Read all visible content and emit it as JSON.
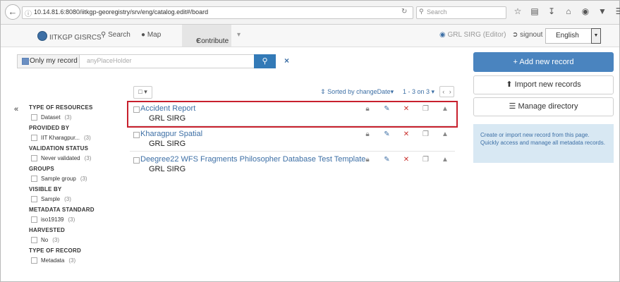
{
  "browser": {
    "back_icon": "back-arrow-icon",
    "url": "10.14.81.6:8080/iitkgp-georegistry/srv/eng/catalog.edit#/board",
    "search_placeholder": "Search"
  },
  "nav": {
    "brand": "IITKGP GISRCS",
    "search": "Search",
    "map": "Map",
    "contribute": "Contribute",
    "user": "GRL SIRG (Editor)",
    "signout": "signout",
    "language": "English"
  },
  "search": {
    "only_my_record": "Only my record",
    "placeholder": "anyPlaceHolder"
  },
  "facets": [
    {
      "heading": "TYPE OF RESOURCES",
      "items": [
        {
          "label": "Dataset",
          "count": "(3)"
        }
      ]
    },
    {
      "heading": "PROVIDED BY",
      "items": [
        {
          "label": "IIT Kharagpur...",
          "count": "(3)"
        }
      ]
    },
    {
      "heading": "VALIDATION STATUS",
      "items": [
        {
          "label": "Never validated",
          "count": "(3)"
        }
      ]
    },
    {
      "heading": "GROUPS",
      "items": [
        {
          "label": "Sample group",
          "count": "(3)"
        }
      ]
    },
    {
      "heading": "VISIBLE BY",
      "items": [
        {
          "label": "Sample",
          "count": "(3)"
        }
      ]
    },
    {
      "heading": "METADATA STANDARD",
      "items": [
        {
          "label": "iso19139",
          "count": "(3)"
        }
      ]
    },
    {
      "heading": "HARVESTED",
      "items": [
        {
          "label": "No",
          "count": "(3)"
        }
      ]
    },
    {
      "heading": "TYPE OF RECORD",
      "items": [
        {
          "label": "Metadata",
          "count": "(3)"
        }
      ]
    }
  ],
  "results": {
    "sorted_by": "Sorted by changeDate",
    "page_count": "1 - 3 on 3",
    "records": [
      {
        "title": "Accident Report",
        "org": "GRL SIRG"
      },
      {
        "title": "Kharagpur Spatial",
        "org": "GRL SIRG"
      },
      {
        "title": "Deegree22 WFS Fragments Philosopher Database Test Template",
        "org": "GRL SIRG"
      }
    ]
  },
  "actions": {
    "add_new_record": "Add new record",
    "import_new_records": "Import new records",
    "manage_directory": "Manage directory",
    "info_text": "Create or import new record from this page. Quickly access and manage all metadata records."
  },
  "colors": {
    "accent": "#337ab7",
    "highlight": "#c8202d",
    "info_bg": "#d8e8f3"
  }
}
